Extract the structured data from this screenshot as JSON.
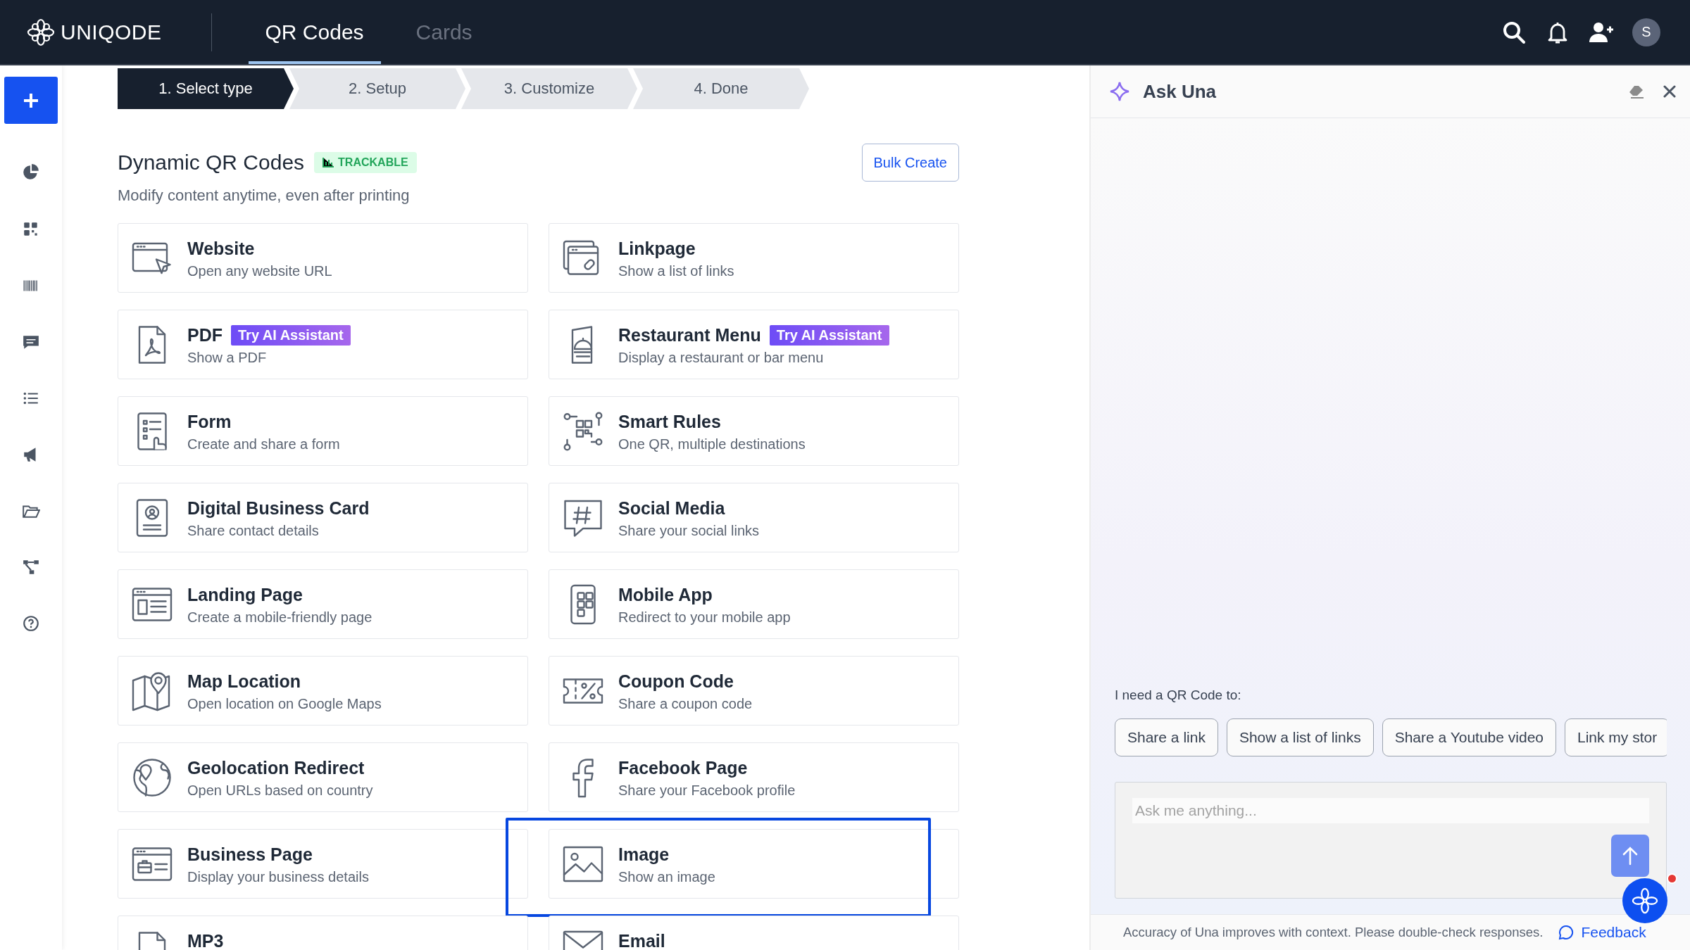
{
  "app": {
    "logo": "UNIQODE"
  },
  "nav_tabs": [
    {
      "label": "QR Codes",
      "selected": true
    },
    {
      "label": "Cards",
      "selected": false
    }
  ],
  "avatar": "S",
  "steps": [
    {
      "label": "1. Select type",
      "selected": true
    },
    {
      "label": "2. Setup",
      "selected": false
    },
    {
      "label": "3. Customize",
      "selected": false
    },
    {
      "label": "4. Done",
      "selected": false
    }
  ],
  "section": {
    "title": "Dynamic QR Codes",
    "badge": "TRACKABLE",
    "subtitle": "Modify content anytime, even after printing",
    "bulk_button": "Bulk Create"
  },
  "cards": [
    {
      "title": "Website",
      "description": "Open any website URL",
      "selected": false
    },
    {
      "title": "Linkpage",
      "description": "Show a list of links",
      "selected": false
    },
    {
      "title": "PDF",
      "badge": "Try AI Assistant",
      "description": "Show a PDF",
      "selected": false
    },
    {
      "title": "Restaurant Menu",
      "badge": "Try AI Assistant",
      "description": "Display a restaurant or bar menu",
      "selected": false
    },
    {
      "title": "Form",
      "description": "Create and share a form",
      "selected": false
    },
    {
      "title": "Smart Rules",
      "description": "One QR, multiple destinations",
      "selected": false
    },
    {
      "title": "Digital Business Card",
      "description": "Share contact details",
      "selected": false
    },
    {
      "title": "Social Media",
      "description": "Share your social links",
      "selected": false
    },
    {
      "title": "Landing Page",
      "description": "Create a mobile-friendly page",
      "selected": false
    },
    {
      "title": "Mobile App",
      "description": "Redirect to your mobile app",
      "selected": false
    },
    {
      "title": "Map Location",
      "description": "Open location on Google Maps",
      "selected": false
    },
    {
      "title": "Coupon Code",
      "description": "Share a coupon code",
      "selected": false
    },
    {
      "title": "Geolocation Redirect",
      "description": "Open URLs based on country",
      "selected": false
    },
    {
      "title": "Facebook Page",
      "description": "Share your Facebook profile",
      "selected": false
    },
    {
      "title": "Business Page",
      "description": "Display your business details",
      "selected": false
    },
    {
      "title": "Image",
      "description": "Show an image",
      "selected": true
    },
    {
      "title": "MP3",
      "selected": false
    },
    {
      "title": "Email",
      "selected": false
    }
  ],
  "assistant": {
    "title": "Ask Una",
    "prompt": "I need a QR Code to:",
    "suggestions": [
      "Share a link",
      "Show a list of links",
      "Share a Youtube video",
      "Link my stor"
    ],
    "input": {
      "placeholder": "Ask me anything..."
    },
    "disclaimer": "Accuracy of Una improves with context. Please double-check responses.",
    "feedback_link": "Feedback"
  }
}
